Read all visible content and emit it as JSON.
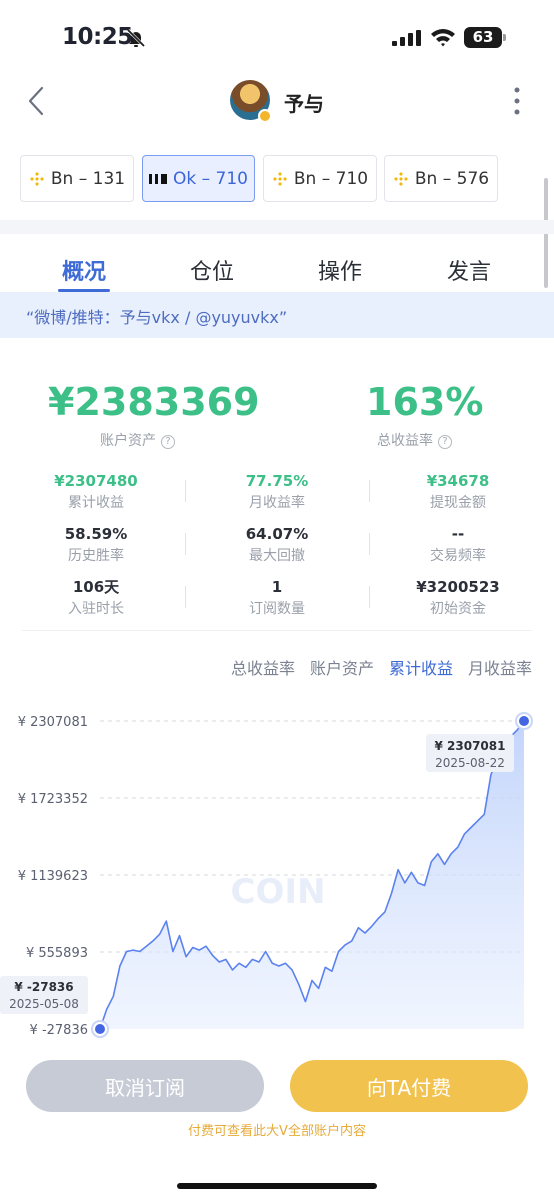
{
  "status_bar": {
    "time": "10:25",
    "battery": "63"
  },
  "header": {
    "title": "予与"
  },
  "exchanges": [
    {
      "label": "Bn – 131",
      "logo": "binance-icon",
      "active": false
    },
    {
      "label": "Ok – 710",
      "logo": "okx-icon",
      "active": true
    },
    {
      "label": "Bn – 710",
      "logo": "binance-icon",
      "active": false
    },
    {
      "label": "Bn – 576",
      "logo": "binance-icon",
      "active": false
    }
  ],
  "tabs": [
    {
      "label": "概况",
      "active": true
    },
    {
      "label": "仓位",
      "active": false
    },
    {
      "label": "操作",
      "active": false
    },
    {
      "label": "发言",
      "active": false
    }
  ],
  "bio": "“微博/推特：予与vkx / @yuyuvkx”",
  "summary": {
    "assets": {
      "value": "¥2383369",
      "label": "账户资产"
    },
    "total_return": {
      "value": "163%",
      "label": "总收益率"
    }
  },
  "stats": [
    {
      "value": "¥2307480",
      "label": "累计收益",
      "green": true
    },
    {
      "value": "77.75%",
      "label": "月收益率",
      "green": true
    },
    {
      "value": "¥34678",
      "label": "提现金额",
      "green": true
    },
    {
      "value": "58.59%",
      "label": "历史胜率",
      "green": false
    },
    {
      "value": "64.07%",
      "label": "最大回撤",
      "green": false
    },
    {
      "value": "--",
      "label": "交易频率",
      "green": false
    },
    {
      "value": "106天",
      "label": "入驻时长",
      "green": false
    },
    {
      "value": "1",
      "label": "订阅数量",
      "green": false
    },
    {
      "value": "¥3200523",
      "label": "初始资金",
      "green": false
    }
  ],
  "chart_tabs": [
    {
      "label": "总收益率",
      "active": false
    },
    {
      "label": "账户资产",
      "active": false
    },
    {
      "label": "累计收益",
      "active": true
    },
    {
      "label": "月收益率",
      "active": false
    }
  ],
  "chart_data": {
    "type": "area",
    "watermark": "COIN",
    "y_ticks": [
      "¥ 2307081",
      "¥ 1723352",
      "¥ 1139623",
      "¥ 555893",
      "¥ -27836"
    ],
    "ylim": [
      -27836,
      2307081
    ],
    "grid": true,
    "start_point": {
      "value": "¥ -27836",
      "date": "2025-05-08",
      "y": -27836
    },
    "end_point": {
      "value": "¥ 2307081",
      "date": "2025-08-22",
      "y": 2307081
    },
    "values": [
      -27836,
      120000,
      220000,
      450000,
      560000,
      570000,
      560000,
      600000,
      640000,
      690000,
      790000,
      560000,
      680000,
      520000,
      590000,
      570000,
      600000,
      530000,
      480000,
      500000,
      420000,
      470000,
      440000,
      500000,
      480000,
      560000,
      470000,
      450000,
      470000,
      420000,
      310000,
      180000,
      340000,
      280000,
      440000,
      410000,
      560000,
      610000,
      640000,
      740000,
      700000,
      750000,
      810000,
      860000,
      1000000,
      1180000,
      1080000,
      1160000,
      1080000,
      1060000,
      1240000,
      1300000,
      1220000,
      1300000,
      1350000,
      1450000,
      1500000,
      1550000,
      1600000,
      1900000,
      2020000,
      2170000,
      2190000,
      2240000,
      2307081
    ]
  },
  "actions": {
    "cancel": "取消订阅",
    "pay": "向TA付费"
  },
  "hint": "付费可查看此大V全部账户内容",
  "colors": {
    "accent": "#3f6bd6",
    "positive": "#3dbf88",
    "pay_button": "#f2c24e",
    "hint": "#e6ab3a"
  }
}
